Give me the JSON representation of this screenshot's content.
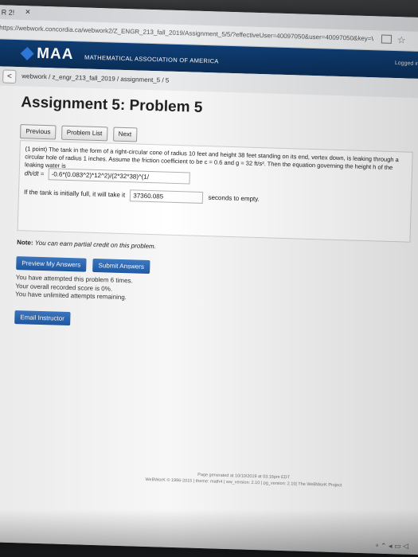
{
  "browser": {
    "tab_label": "R 2!",
    "tab_close": "×",
    "url": "https://webwork.concordia.ca/webwork2/Z_ENGR_213_fall_2019/Assignment_5/5/?effectiveUser=40097050&user=40097050&key=WLDV0swDGIanYXyj1ipLbIKQd9pyw4jGT",
    "bookmark_icon": "star-icon"
  },
  "header": {
    "logo_text": "MAA",
    "subtitle": "MATHEMATICAL ASSOCIATION OF AMERICA",
    "logged_in": "Logged in as"
  },
  "breadcrumb": {
    "back_glyph": "<",
    "path": "webwork / z_engr_213_fall_2019 / assignment_5 / 5"
  },
  "main": {
    "title": "Assignment 5: Problem 5",
    "nav": {
      "previous": "Previous",
      "problem_list": "Problem List",
      "next": "Next"
    },
    "problem": {
      "statement": "(1 point) The tank in the form of a right-circular cone of radius 10 feet and height 38 feet standing on its end, vertex down, is leaking through a circular hole of radius 1 inches. Assume the friction coefficient to be c = 0.6 and g = 32 ft/s². Then the equation governing the height h of the leaking water is",
      "dhdt_label": "dh/dt =",
      "answer1_value": "-0.6*(0.083^2)*12^2)/(2*32*38)^(1/",
      "time_prefix": "If the tank is initially full, it will take it",
      "answer2_value": "37360.085",
      "time_suffix": "seconds to empty."
    },
    "note_label": "Note:",
    "note_text": "You can earn partial credit on this problem.",
    "preview_button": "Preview My Answers",
    "submit_button": "Submit Answers",
    "status": [
      "You have attempted this problem 6 times.",
      "Your overall recorded score is 0%.",
      "You have unlimited attempts remaining."
    ],
    "email_button": "Email Instructor"
  },
  "footer": {
    "line1": "Page generated at 10/10/2019 at 03:16pm EDT",
    "line2": "WeBWorK © 1996-2015 | theme: math4 | ww_version: 2.10 | pg_version: 2.10| The WeBWorK Project"
  },
  "tray": "⁹ ⌃ ◂ ▭ ◁"
}
